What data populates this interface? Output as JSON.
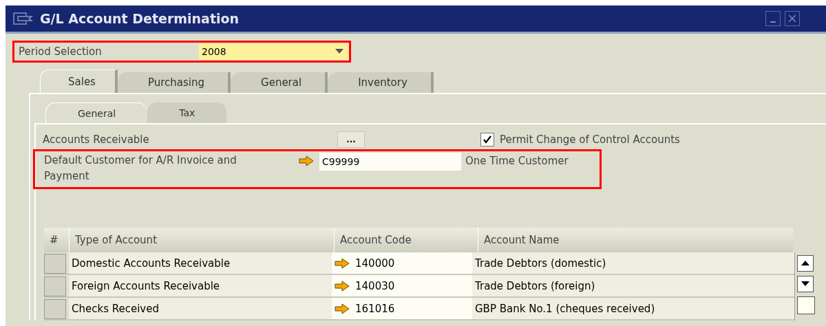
{
  "window": {
    "title": "G/L Account Determination"
  },
  "period_selection": {
    "label": "Period Selection",
    "value": "2008",
    "highlighted": true
  },
  "tabs": [
    {
      "label": "Sales",
      "selected": true
    },
    {
      "label": "Purchasing",
      "selected": false
    },
    {
      "label": "General",
      "selected": false
    },
    {
      "label": "Inventory",
      "selected": false
    }
  ],
  "subtabs": [
    {
      "label": "General",
      "selected": true
    },
    {
      "label": "Tax",
      "selected": false
    }
  ],
  "accounts_receivable": {
    "label": "Accounts Receivable",
    "button": "..."
  },
  "permit_change": {
    "label": "Permit Change of Control Accounts",
    "checked": true
  },
  "default_customer": {
    "label": "Default Customer for A/R Invoice and Payment",
    "value": "C99999",
    "name": "One Time Customer",
    "highlighted": true
  },
  "table": {
    "columns": [
      "#",
      "Type of Account",
      "Account Code",
      "Account Name"
    ],
    "rows": [
      {
        "type": "Domestic Accounts Receivable",
        "code": "140000",
        "name": "Trade Debtors (domestic)"
      },
      {
        "type": "Foreign Accounts Receivable",
        "code": "140030",
        "name": "Trade Debtors (foreign)"
      },
      {
        "type": "Checks Received",
        "code": "161016",
        "name": "GBP Bank No.1 (cheques received)"
      }
    ]
  }
}
